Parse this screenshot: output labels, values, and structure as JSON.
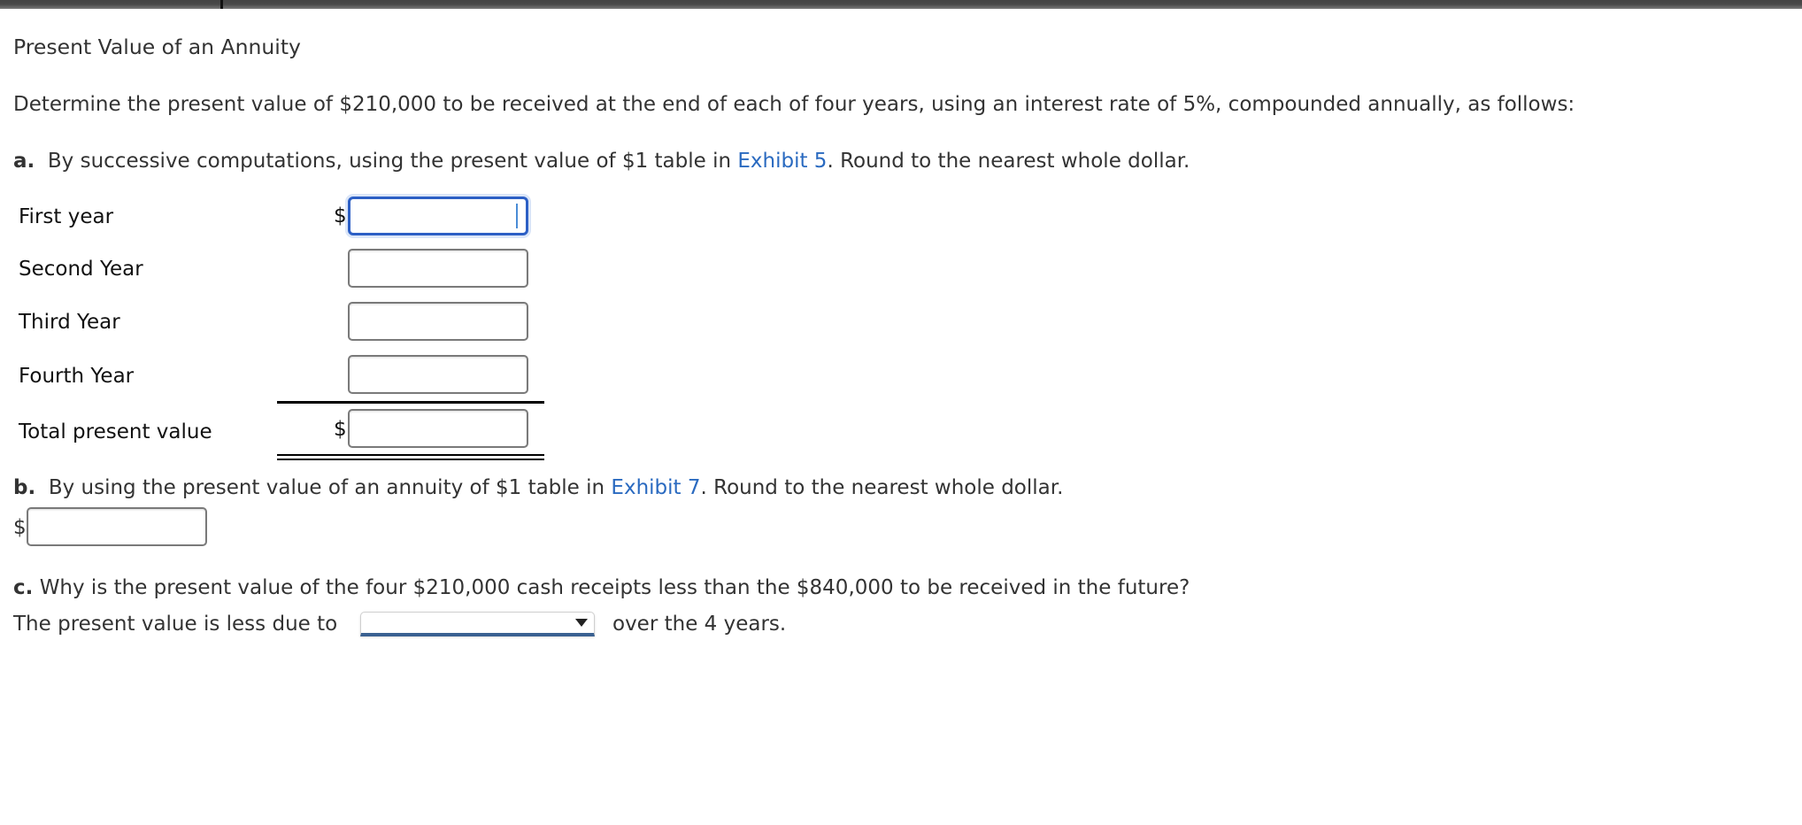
{
  "page": {
    "title": "Present Value of an Annuity",
    "intro": "Determine the present value of $210,000 to be received at the end of each of four years, using an interest rate of 5%, compounded annually, as follows:"
  },
  "part_a": {
    "marker": "a.",
    "text_before": "By successive computations, using the present value of $1 table in",
    "link": "Exhibit 5",
    "text_after": ". Round to the nearest whole dollar.",
    "currency": "$",
    "rows": [
      {
        "label": "First year",
        "value": "",
        "show_currency": true,
        "focused": true
      },
      {
        "label": "Second Year",
        "value": "",
        "show_currency": false
      },
      {
        "label": "Third Year",
        "value": "",
        "show_currency": false
      },
      {
        "label": "Fourth Year",
        "value": "",
        "show_currency": false
      }
    ],
    "total": {
      "label": "Total present value",
      "value": ""
    }
  },
  "part_b": {
    "marker": "b.",
    "text_before": "By using the present value of an annuity of $1 table in",
    "link": "Exhibit 7",
    "text_after": ". Round to the nearest whole dollar.",
    "currency": "$",
    "value": ""
  },
  "part_c": {
    "marker": "c.",
    "question": "Why is the present value of the four $210,000 cash receipts less than the $840,000 to be received in the future?",
    "answer_prefix": "The present value is less due to",
    "answer_selected": "",
    "answer_suffix": "over the 4 years."
  },
  "colors": {
    "link": "#2a6ac0",
    "focus": "#2c5fc5",
    "select_underline": "#3a6191"
  }
}
